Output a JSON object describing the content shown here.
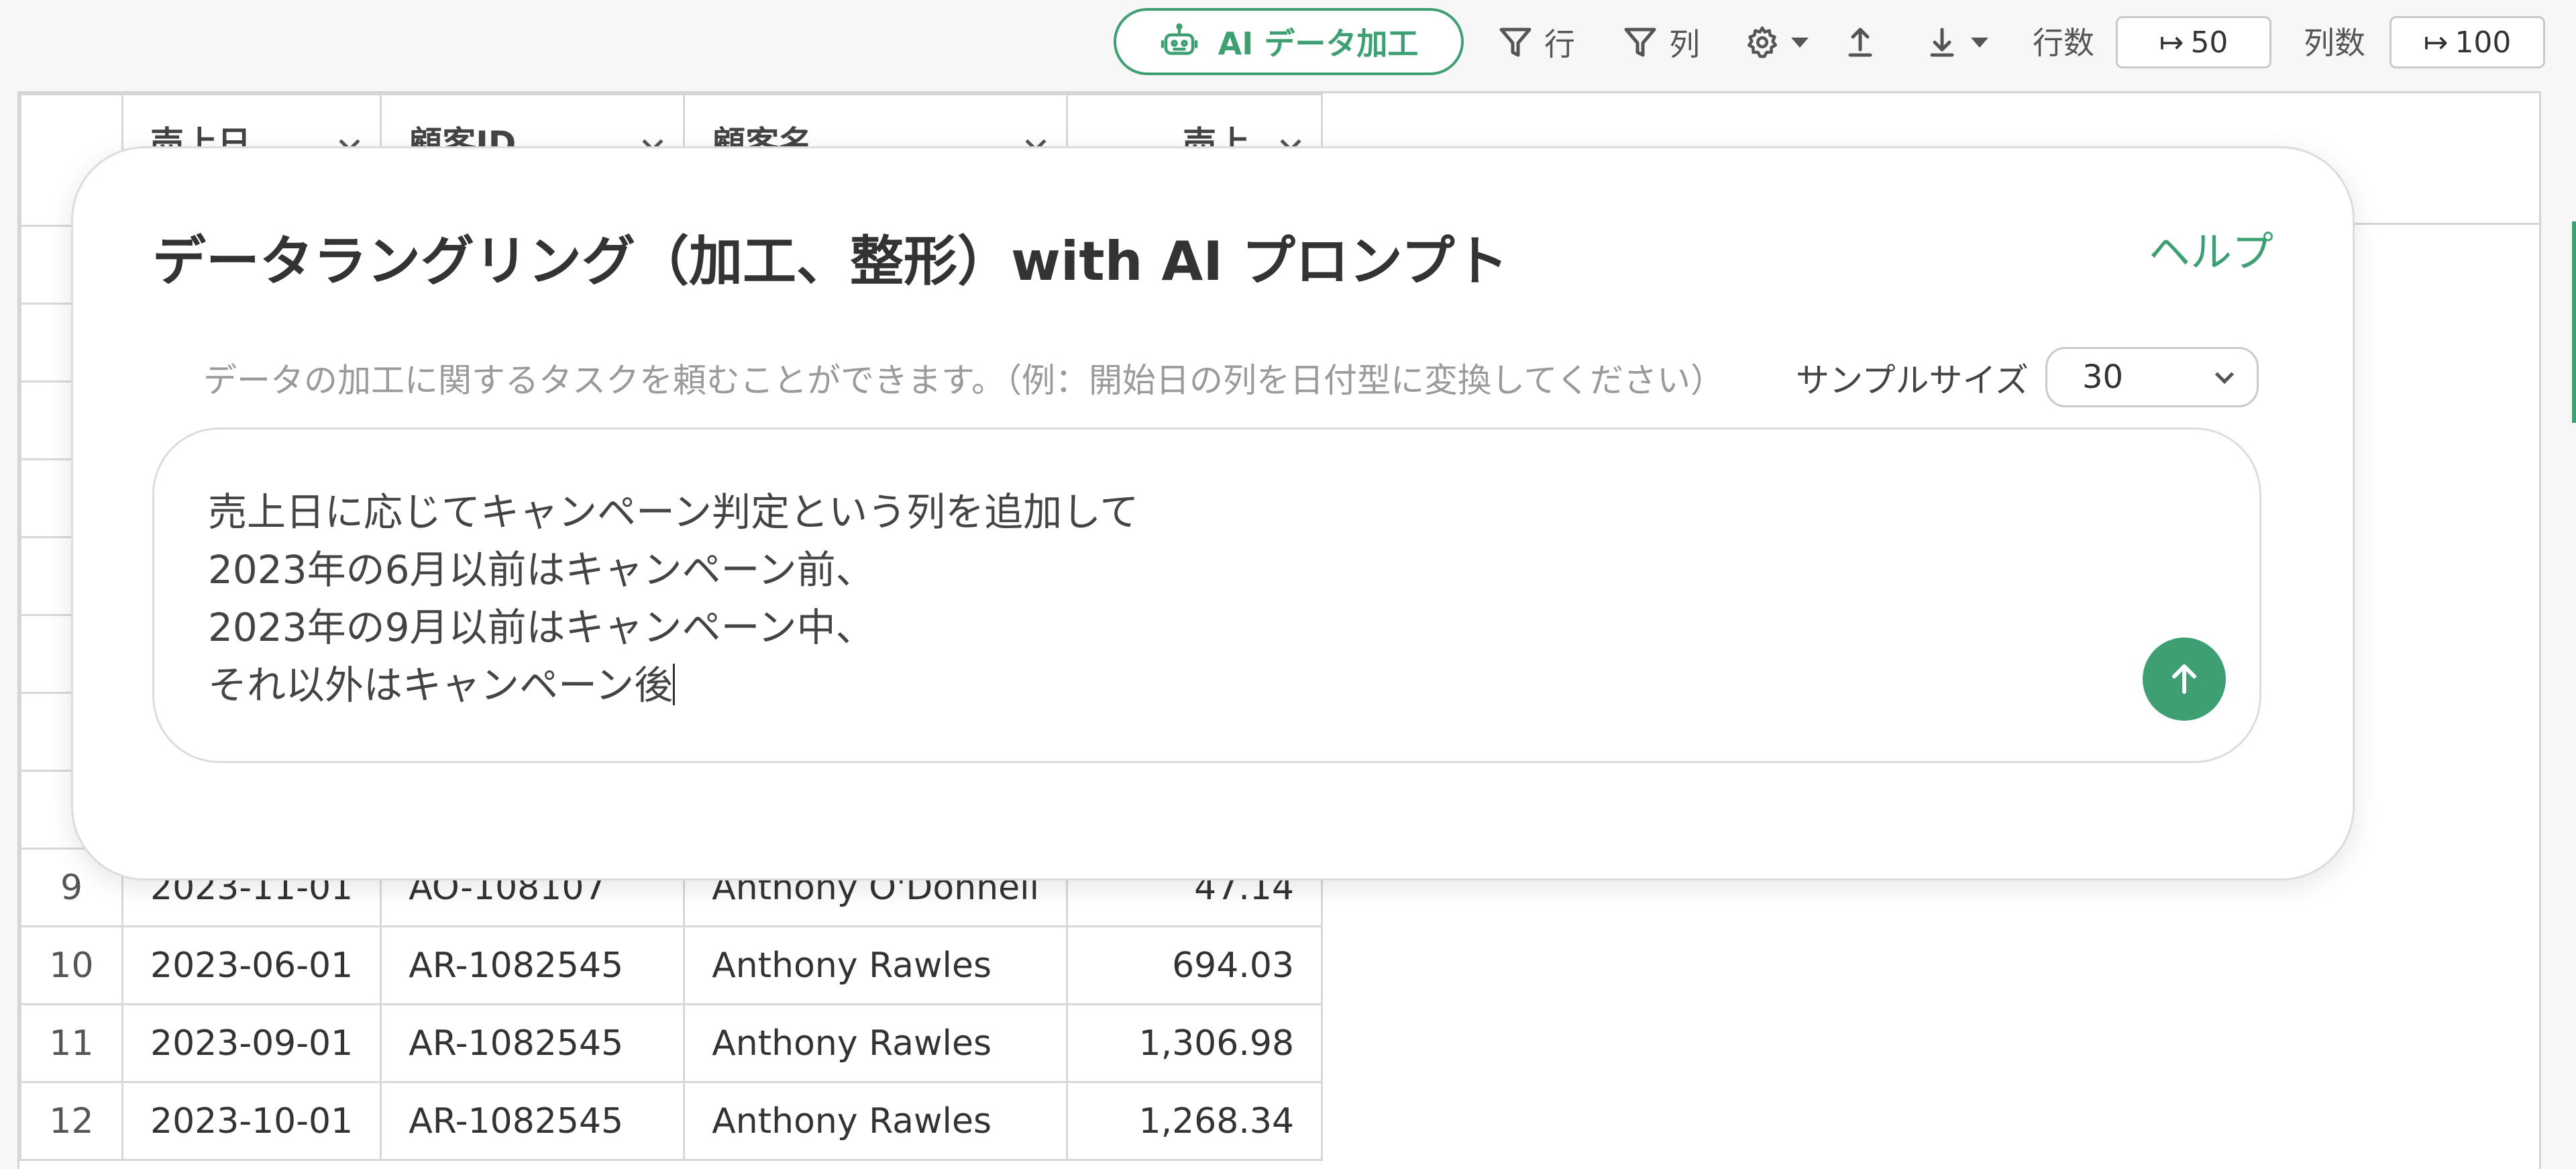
{
  "toolbar": {
    "ai_button_label": "AI データ加工",
    "row_filter_label": "行",
    "column_filter_label": "列",
    "row_count_label": "行数",
    "row_count_value": "50",
    "column_count_label": "列数",
    "column_count_value": "100"
  },
  "grid": {
    "columns": [
      "売上日",
      "顧客ID",
      "顧客名",
      "売上"
    ],
    "rows": [
      {
        "n": "9",
        "date": "2023-11-01",
        "id": "AO-108107",
        "name": "Anthony O'Donnell",
        "sales": "47.14"
      },
      {
        "n": "10",
        "date": "2023-06-01",
        "id": "AR-1082545",
        "name": "Anthony Rawles",
        "sales": "694.03"
      },
      {
        "n": "11",
        "date": "2023-09-01",
        "id": "AR-1082545",
        "name": "Anthony Rawles",
        "sales": "1,306.98"
      },
      {
        "n": "12",
        "date": "2023-10-01",
        "id": "AR-1082545",
        "name": "Anthony Rawles",
        "sales": "1,268.34"
      }
    ]
  },
  "modal": {
    "title": "データラングリング（加工、整形）with AI プロンプト",
    "help_label": "ヘルプ",
    "hint": "データの加工に関するタスクを頼むことができます。（例：開始日の列を日付型に変換してください）",
    "sample_size_label": "サンプルサイズ",
    "sample_size_value": "30",
    "prompt_lines": [
      "売上日に応じてキャンペーン判定という列を追加して",
      "2023年の6月以前はキャンペーン前、",
      "2023年の9月以前はキャンペーン中、",
      "それ以外はキャンペーン後"
    ]
  },
  "colors": {
    "accent": "#3ea072"
  }
}
